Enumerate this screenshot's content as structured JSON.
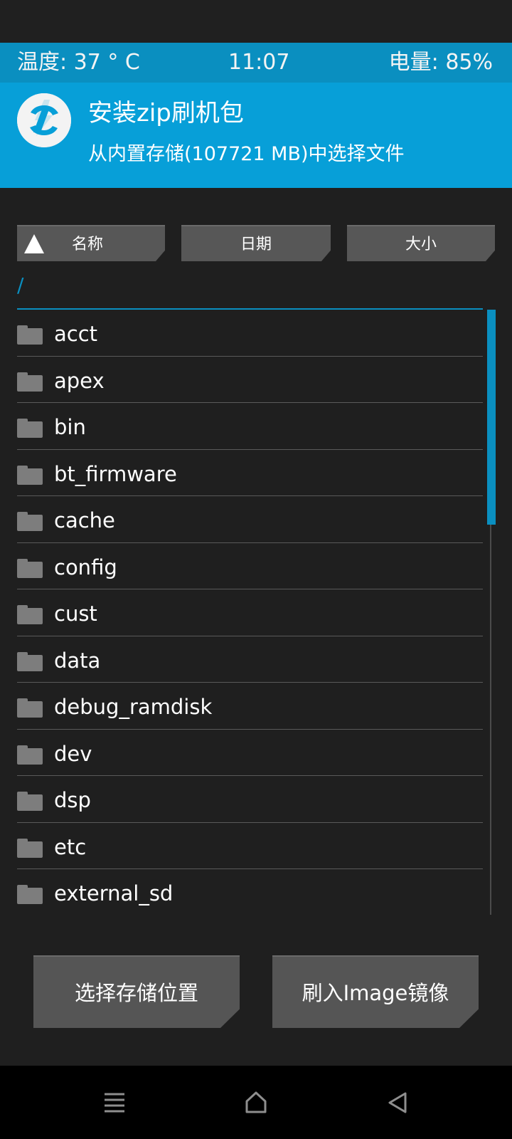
{
  "status_bar": {
    "temperature": "温度: 37 ° C",
    "time": "11:07",
    "battery": "电量: 85%"
  },
  "header": {
    "logo_icon": "twrp-logo-icon",
    "title": "安装zip刷机包",
    "subtitle": "从内置存储(107721 MB)中选择文件"
  },
  "sort_buttons": {
    "name": "名称",
    "date": "日期",
    "size": "大小",
    "active_sort_icon": "sort-ascending-icon"
  },
  "current_path": "/",
  "files": [
    {
      "name": "acct",
      "type": "folder"
    },
    {
      "name": "apex",
      "type": "folder"
    },
    {
      "name": "bin",
      "type": "folder"
    },
    {
      "name": "bt_firmware",
      "type": "folder"
    },
    {
      "name": "cache",
      "type": "folder"
    },
    {
      "name": "config",
      "type": "folder"
    },
    {
      "name": "cust",
      "type": "folder"
    },
    {
      "name": "data",
      "type": "folder"
    },
    {
      "name": "debug_ramdisk",
      "type": "folder"
    },
    {
      "name": "dev",
      "type": "folder"
    },
    {
      "name": "dsp",
      "type": "folder"
    },
    {
      "name": "etc",
      "type": "folder"
    },
    {
      "name": "external_sd",
      "type": "folder"
    }
  ],
  "actions": {
    "select_storage": "选择存储位置",
    "flash_image": "刷入Image镜像"
  },
  "nav": {
    "menu_icon": "menu-icon",
    "home_icon": "home-icon",
    "back_icon": "back-icon"
  },
  "colors": {
    "accent": "#079fd8",
    "status_bar": "#0a8fc0",
    "background": "#1f1f1f",
    "button": "#575757",
    "folder": "#7d7d7d"
  }
}
